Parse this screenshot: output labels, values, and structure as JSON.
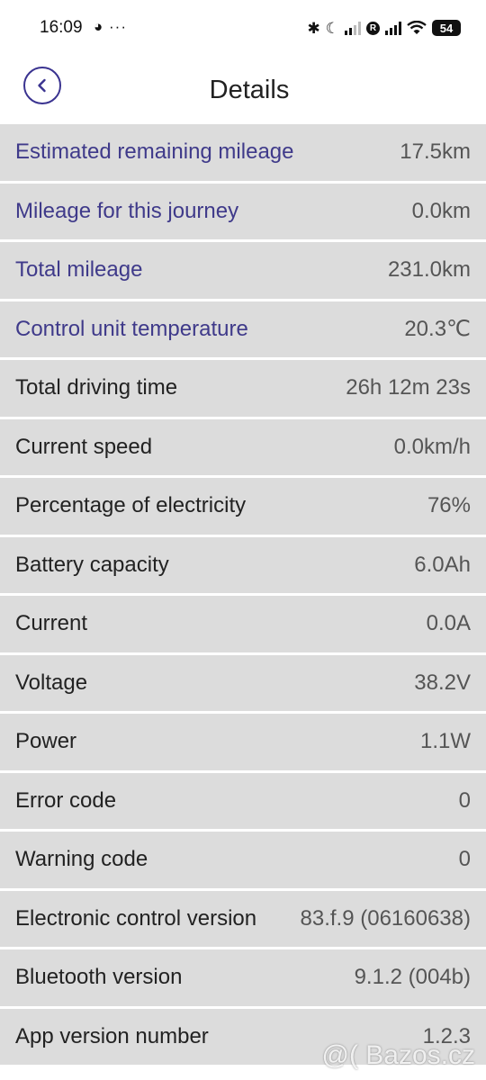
{
  "status_bar": {
    "time": "16:09",
    "left_icons": "◕ ···",
    "bluetooth": "✱",
    "dnd": "☾",
    "r_badge": "R",
    "battery": "54"
  },
  "header": {
    "title": "Details",
    "back_icon": "chevron-left-circle-icon"
  },
  "details": [
    {
      "label": "Estimated remaining mileage",
      "value": "17.5km",
      "accent": true
    },
    {
      "label": "Mileage for this journey",
      "value": "0.0km",
      "accent": true
    },
    {
      "label": "Total mileage",
      "value": "231.0km",
      "accent": true
    },
    {
      "label": "Control unit temperature",
      "value": "20.3℃",
      "accent": true
    },
    {
      "label": "Total driving time",
      "value": "26h 12m 23s",
      "accent": false
    },
    {
      "label": "Current speed",
      "value": "0.0km/h",
      "accent": false
    },
    {
      "label": "Percentage of electricity",
      "value": "76%",
      "accent": false
    },
    {
      "label": "Battery capacity",
      "value": "6.0Ah",
      "accent": false
    },
    {
      "label": "Current",
      "value": "0.0A",
      "accent": false
    },
    {
      "label": "Voltage",
      "value": "38.2V",
      "accent": false
    },
    {
      "label": "Power",
      "value": "1.1W",
      "accent": false
    },
    {
      "label": "Error code",
      "value": "0",
      "accent": false
    },
    {
      "label": "Warning code",
      "value": "0",
      "accent": false
    },
    {
      "label": "Electronic control version",
      "value": "83.f.9 (06160638)",
      "accent": false
    },
    {
      "label": "Bluetooth version",
      "value": "9.1.2 (004b)",
      "accent": false
    },
    {
      "label": "App version number",
      "value": "1.2.3",
      "accent": false
    }
  ],
  "watermark": "@( Bazos.cz",
  "colors": {
    "accent": "#3f3a8a",
    "row_bg": "#dcdcdc",
    "value_text": "#555555"
  }
}
